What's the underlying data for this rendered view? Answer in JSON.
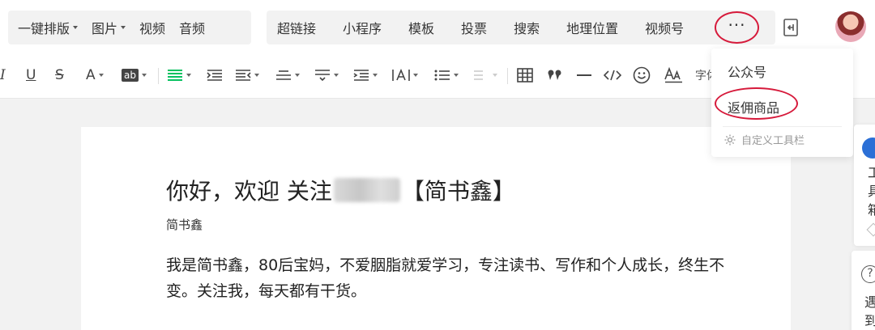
{
  "top_toolbar": {
    "group_a": [
      {
        "label": "一键排版",
        "dropdown": true
      },
      {
        "label": "图片",
        "dropdown": true
      },
      {
        "label": "视频",
        "dropdown": false
      },
      {
        "label": "音频",
        "dropdown": false
      }
    ],
    "group_b": [
      "超链接",
      "小程序",
      "模板",
      "投票",
      "搜索",
      "地理位置",
      "视频号"
    ],
    "more_label": "···"
  },
  "format_toolbar": {
    "italic": "I",
    "underline": "U",
    "strike": "S",
    "font_color": "A",
    "highlight": "ab",
    "font_size_label": "字体"
  },
  "more_menu": {
    "items": [
      "公众号",
      "返佣商品"
    ],
    "custom_toolbar_label": "自定义工具栏"
  },
  "side_panel_1": {
    "text": "工具箱"
  },
  "side_panel_2": {
    "text": "遇到"
  },
  "document": {
    "title_before": "你好，欢迎 关注 ",
    "title_after": "【简书鑫】",
    "author": "简书鑫",
    "body": "我是简书鑫，80后宝妈，不爱胭脂就爱学习，专注读书、写作和个人成长，终生不变。关注我，每天都有干货。"
  },
  "colors": {
    "accent_green": "#07c160",
    "annotation_red": "#d61a3b"
  }
}
